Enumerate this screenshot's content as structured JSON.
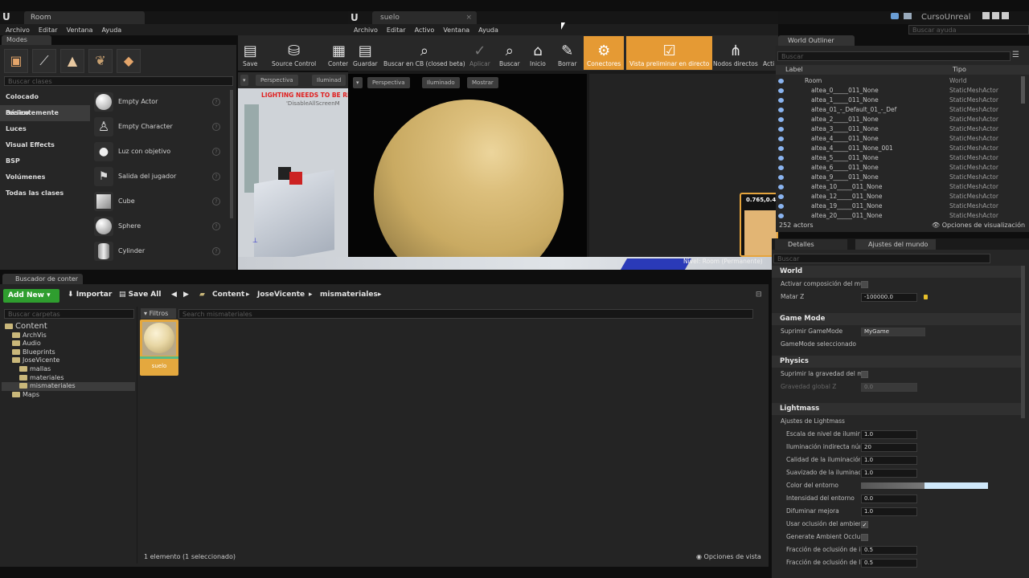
{
  "app": {
    "main_tab": "Room",
    "project_name": "CursoUnreal",
    "help_search_placeholder": "Buscar ayuda"
  },
  "menu": [
    "Archivo",
    "Editar",
    "Ventana",
    "Ayuda"
  ],
  "modes": {
    "tab_label": "Modes",
    "search_placeholder": "Buscar clases",
    "categories": [
      "Colocado recientemente",
      "Básico",
      "Luces",
      "Visual Effects",
      "BSP",
      "Volúmenes",
      "Todas las clases"
    ],
    "items": [
      "Empty Actor",
      "Empty Character",
      "Luz con objetivo",
      "Salida del jugador",
      "Cube",
      "Sphere",
      "Cylinder"
    ]
  },
  "toolbar": {
    "buttons": [
      "Save",
      "Source Control",
      "Conten"
    ]
  },
  "viewport": {
    "perspective": "Perspectiva",
    "lit": "Iluminad",
    "warning": "LIGHTING NEEDS TO BE RE",
    "warning_sub": "'DisableAllScreenM",
    "level_label": "Nivel:  Room (Permanente)"
  },
  "material_editor": {
    "tab_label": "suelo",
    "menu": [
      "Archivo",
      "Editar",
      "Activo",
      "Ventana",
      "Ayuda"
    ],
    "toolbar": [
      "Guardar",
      "Buscar en CB (closed beta)",
      "Aplicar",
      "Buscar",
      "Inicio",
      "Borrar",
      "Conectores",
      "Vista preliminar en directo",
      "Nodos directos",
      "Acti"
    ],
    "preview_buttons": [
      "Perspectiva",
      "Iluminado",
      "Mostrar"
    ],
    "node_value": "0.765,0.45"
  },
  "world_outliner": {
    "tab_label": "World Outliner",
    "search_placeholder": "Buscar",
    "col_label": "Label",
    "col_type": "Tipo",
    "rows": [
      {
        "label": "Room",
        "type": "World"
      },
      {
        "label": "altea_0_____011_None",
        "type": "StaticMeshActor"
      },
      {
        "label": "altea_1_____011_None",
        "type": "StaticMeshActor"
      },
      {
        "label": "altea_01_-_Default_01_-_Def",
        "type": "StaticMeshActor"
      },
      {
        "label": "altea_2_____011_None",
        "type": "StaticMeshActor"
      },
      {
        "label": "altea_3_____011_None",
        "type": "StaticMeshActor"
      },
      {
        "label": "altea_4_____011_None",
        "type": "StaticMeshActor"
      },
      {
        "label": "altea_4_____011_None_001",
        "type": "StaticMeshActor"
      },
      {
        "label": "altea_5_____011_None",
        "type": "StaticMeshActor"
      },
      {
        "label": "altea_6_____011_None",
        "type": "StaticMeshActor"
      },
      {
        "label": "altea_9_____011_None",
        "type": "StaticMeshActor"
      },
      {
        "label": "altea_10_____011_None",
        "type": "StaticMeshActor"
      },
      {
        "label": "altea_12_____011_None",
        "type": "StaticMeshActor"
      },
      {
        "label": "altea_19_____011_None",
        "type": "StaticMeshActor"
      },
      {
        "label": "altea_20_____011_None",
        "type": "StaticMeshActor"
      }
    ],
    "actor_count": "252 actors",
    "view_options": "Opciones de visualización"
  },
  "details": {
    "tab_details": "Detalles",
    "tab_world": "Ajustes del mundo",
    "search_placeholder": "Buscar",
    "world": {
      "title": "World",
      "p1": "Activar composición del mur",
      "p2": "Matar Z",
      "p2_val": "-100000.0"
    },
    "gamemode": {
      "title": "Game Mode",
      "p1": "Suprimir GameMode",
      "p1_val": "MyGame",
      "p2": "GameMode seleccionado"
    },
    "physics": {
      "title": "Physics",
      "p1": "Suprimir la gravedad del mur",
      "p2": "Gravedad global Z",
      "p2_val": "0.0"
    },
    "lightmass": {
      "title": "Lightmass",
      "sub": "Ajustes de Lightmass",
      "props": [
        {
          "label": "Escala de nivel de iluminac",
          "value": "1.0"
        },
        {
          "label": "Iluminación indirecta núm",
          "value": "20"
        },
        {
          "label": "Calidad de la iluminación in",
          "value": "1.0"
        },
        {
          "label": "Suavizado de la iluminació",
          "value": "1.0"
        },
        {
          "label": "Color del entorno",
          "value": ""
        },
        {
          "label": "Intensidad del entorno",
          "value": "0.0"
        },
        {
          "label": "Difuminar mejora",
          "value": "1.0"
        },
        {
          "label": "Usar oclusión del ambient",
          "value": ""
        },
        {
          "label": "Generate Ambient Occlusio",
          "value": ""
        },
        {
          "label": "Fracción de oclusión de ilu",
          "value": "0.5"
        },
        {
          "label": "Fracción de oclusión de la",
          "value": "0.5"
        }
      ]
    }
  },
  "content_browser": {
    "tab_label": "Buscador de conter",
    "add_new": "Add New",
    "import": "Importar",
    "save_all": "Save All",
    "breadcrumb": [
      "Content",
      "JoseVicente",
      "mismateriales"
    ],
    "folder_search": "Buscar carpetas",
    "filters": "Filtros",
    "asset_search": "Search mismateriales",
    "tree": [
      {
        "label": "Content",
        "depth": 0
      },
      {
        "label": "ArchVis",
        "depth": 1
      },
      {
        "label": "Audio",
        "depth": 1
      },
      {
        "label": "Blueprints",
        "depth": 1
      },
      {
        "label": "JoseVicente",
        "depth": 1
      },
      {
        "label": "mallas",
        "depth": 2
      },
      {
        "label": "materiales",
        "depth": 2
      },
      {
        "label": "mismateriales",
        "depth": 2
      },
      {
        "label": "Maps",
        "depth": 1
      }
    ],
    "asset_name": "suelo",
    "status": "1 elemento (1 seleccionado)",
    "view_options": "Opciones de vista"
  }
}
